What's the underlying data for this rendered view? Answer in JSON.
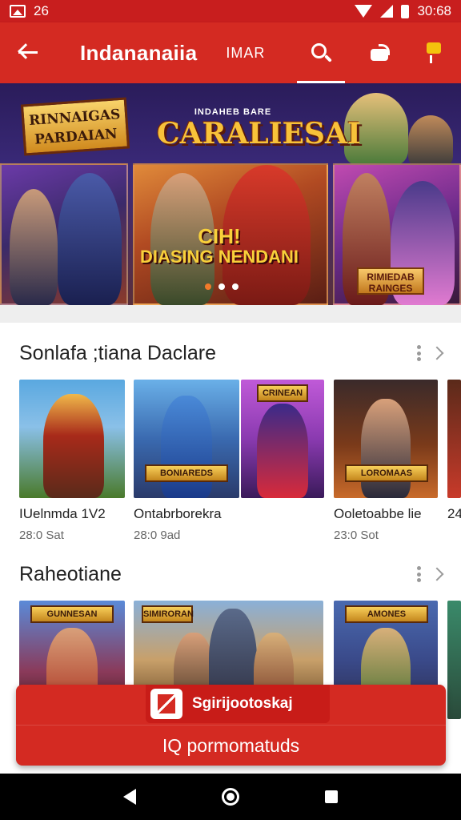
{
  "status_bar": {
    "left_text": "26",
    "time": "30:68"
  },
  "app_bar": {
    "title": "Indananaiia",
    "tab_label": "IMAR",
    "icons": [
      "back-arrow-icon",
      "search-icon",
      "cast-icon",
      "cart-icon"
    ]
  },
  "banner": {
    "logo_left": "RINNAIGAS PARDAIAN",
    "headline_top": "INDAHEB BARE",
    "headline": "CARALIESAI",
    "mid_line1": "CIH!",
    "mid_line2": "DIASING NENDANI",
    "right_badge": "RIMIEDAB RAINGES",
    "slides": 3,
    "active_slide": 1
  },
  "sections": [
    {
      "title": "Sonlafa ;tiana Daclare",
      "cards": [
        {
          "title": "IUelnmda 1V2",
          "meta": "28:0 Sat",
          "tag": ""
        },
        {
          "title": "Ontabrborekra",
          "meta": "28:0 9ad",
          "tag": "BONIAREDS"
        },
        {
          "title": "",
          "meta": "",
          "tag": "CRINEAN"
        },
        {
          "title": "Ooletoabbe lie",
          "meta": "23:0 Sot",
          "tag": "LOROMAAS"
        },
        {
          "title": "24",
          "meta": "",
          "tag": ""
        }
      ]
    },
    {
      "title": "Raheotiane",
      "cards": [
        {
          "title": "",
          "meta": "",
          "tag": "GUNNESAN"
        },
        {
          "title": "",
          "meta": "",
          "tag": "SIMIRORAN"
        },
        {
          "title": "",
          "meta": "",
          "tag": ""
        },
        {
          "title": "",
          "meta": "",
          "tag": "AMONES"
        },
        {
          "title": "",
          "meta": "",
          "tag": ""
        }
      ]
    }
  ],
  "promo": {
    "top_label": "Sgirijootoskaj",
    "bottom_label": "IQ pormomatuds"
  },
  "colors": {
    "primary": "#d42a22",
    "status_bar": "#c81e1e",
    "accent_gold": "#f8c23a"
  }
}
